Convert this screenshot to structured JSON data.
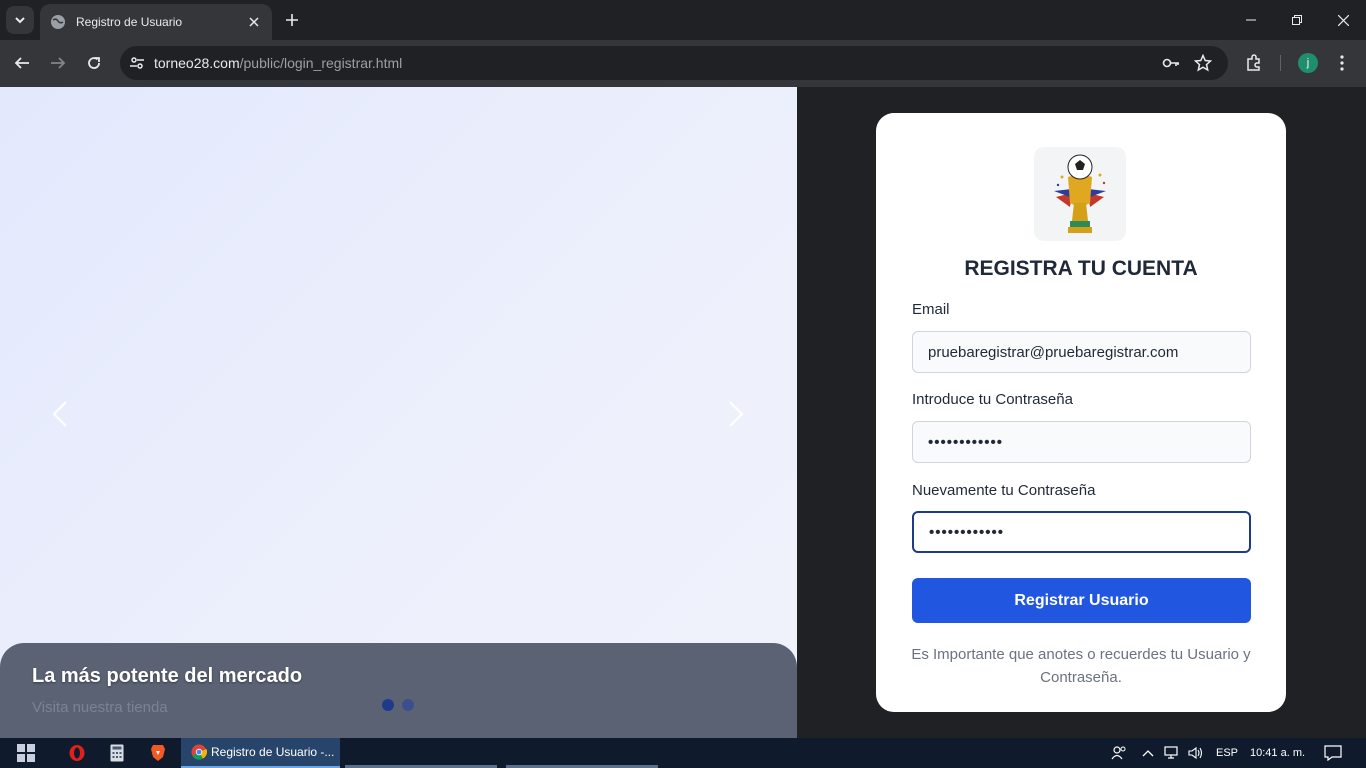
{
  "browser": {
    "tab_title": "Registro de Usuario",
    "url_host": "torneo28.com",
    "url_path": "/public/login_registrar.html",
    "profile_initial": "j"
  },
  "carousel": {
    "caption_title": "La más potente del mercado",
    "caption_subtitle": "Visita nuestra tienda",
    "dots": 2
  },
  "form": {
    "heading": "REGISTRA TU CUENTA",
    "email_label": "Email",
    "email_value": "pruebaregistrar@pruebaregistrar.com",
    "password_label": "Introduce tu Contraseña",
    "password_value": "••••••••••••",
    "confirm_label": "Nuevamente tu Contraseña",
    "confirm_value": "••••••••••••",
    "submit_label": "Registrar Usuario",
    "note": "Es Importante que anotes o recuerdes tu Usuario y Contraseña."
  },
  "taskbar": {
    "active_app_label": "Registro de Usuario -...",
    "language": "ESP",
    "time": "10:41 a. m."
  },
  "colors": {
    "primary_button": "#2157e0",
    "heading": "#1f2937"
  }
}
